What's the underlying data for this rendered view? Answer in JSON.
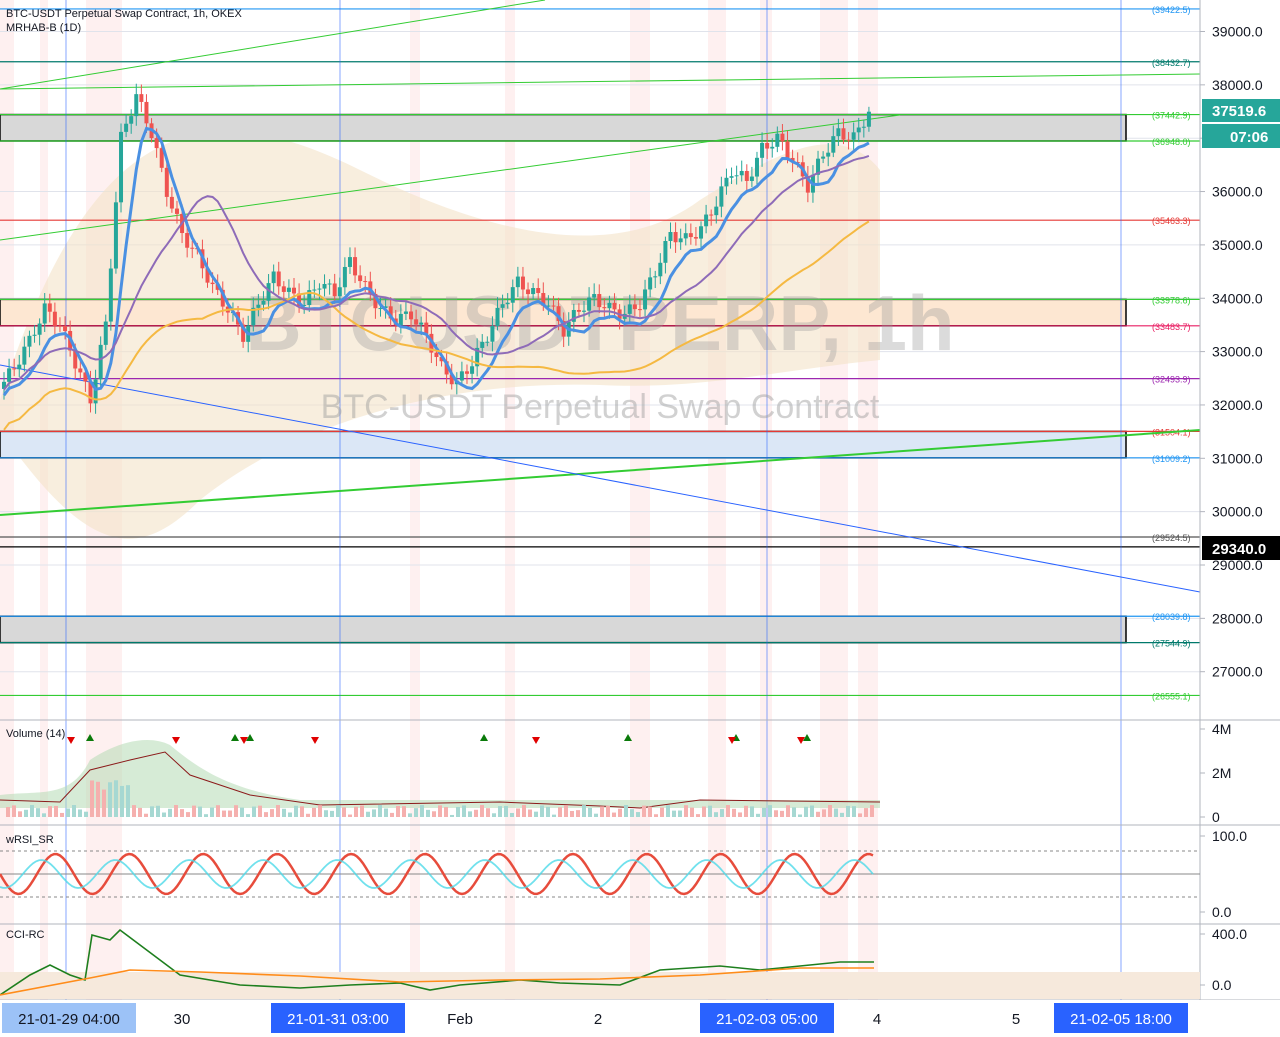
{
  "header": {
    "symbol_line": "BTC-USDT Perpetual Swap Contract, 1h, OKEX",
    "indicator_line": "MRHAB-B (1D)"
  },
  "watermark": {
    "ticker": "BTCUSDTPERP, 1h",
    "description": "BTC-USDT Perpetual Swap Contract"
  },
  "colors": {
    "up": "#26a69a",
    "down": "#ef5350",
    "bg": "#ffffff",
    "grid": "#e0e3eb",
    "axis_text": "#131722",
    "level_box": "#000000",
    "ema_fast": "#4a90e2",
    "ema_slow": "#f5b942",
    "trend_green": "#33cc33"
  },
  "price_axis": {
    "ticks": [
      "39000.0",
      "38000.0",
      "37000.0",
      "36000.0",
      "35000.0",
      "34000.0",
      "33000.0",
      "32000.0",
      "31000.0",
      "30000.0",
      "29000.0",
      "28000.0",
      "27000.0"
    ],
    "tick_values": [
      39000,
      38000,
      37000,
      36000,
      35000,
      34000,
      33000,
      32000,
      31000,
      30000,
      29000,
      28000,
      27000
    ],
    "current_price": "37519.6",
    "countdown": "07:06",
    "crosshair_price": "29340.0"
  },
  "levels": [
    {
      "label": "(39422.5)",
      "value": 39422.5,
      "color": "#2196f3"
    },
    {
      "label": "(38432.7)",
      "value": 38432.7,
      "color": "#00796b"
    },
    {
      "label": "(37442.9)",
      "value": 37442.9,
      "color": "#33cc33"
    },
    {
      "label": "(36948.0)",
      "value": 36948.0,
      "color": "#33cc33"
    },
    {
      "label": "(35463.3)",
      "value": 35463.3,
      "color": "#e53935"
    },
    {
      "label": "(33978.6)",
      "value": 33978.6,
      "color": "#33cc33"
    },
    {
      "label": "(33483.7)",
      "value": 33483.7,
      "color": "#e91e63"
    },
    {
      "label": "(32493.9)",
      "value": 32493.9,
      "color": "#9c27b0"
    },
    {
      "label": "(31504.1)",
      "value": 31504.1,
      "color": "#e53935"
    },
    {
      "label": "(31009.2)",
      "value": 31009.2,
      "color": "#2196f3"
    },
    {
      "label": "(29524.5)",
      "value": 29524.5,
      "color": "#555555"
    },
    {
      "label": "(28039.8)",
      "value": 28039.8,
      "color": "#2196f3"
    },
    {
      "label": "(27544.9)",
      "value": 27544.9,
      "color": "#00796b"
    },
    {
      "label": "(26555.1)",
      "value": 26555.1,
      "color": "#33cc33"
    }
  ],
  "zones": [
    {
      "top": 37442.9,
      "bottom": 36948.0,
      "fill": "#d8d8d8"
    },
    {
      "top": 33978.6,
      "bottom": 33483.7,
      "fill": "#fde7d2"
    },
    {
      "top": 31504.1,
      "bottom": 31009.2,
      "fill": "#dbe7f6"
    },
    {
      "top": 28039.8,
      "bottom": 27544.9,
      "fill": "#d8d8d8"
    }
  ],
  "volume_panel": {
    "title": "Volume (14)",
    "ticks": [
      "4M",
      "2M",
      "0"
    ]
  },
  "wrsi_panel": {
    "title": "wRSI_SR",
    "ticks": [
      "100.0",
      "0.0"
    ]
  },
  "cci_panel": {
    "title": "CCI-RC",
    "ticks": [
      "400.0",
      "0.0"
    ]
  },
  "time_axis": {
    "labels": [
      "21-01-29   04:00",
      "30",
      "21-01-31   03:00",
      "Feb",
      "2",
      "21-02-03   05:00",
      "4",
      "5",
      "21-02-05   18:00"
    ],
    "highlighted": [
      true,
      false,
      true,
      false,
      false,
      true,
      false,
      false,
      true
    ]
  },
  "chart_data": {
    "type": "candlestick",
    "title": "BTC-USDT Perpetual Swap Contract, 1h, OKEX",
    "ylim": [
      26000,
      39700
    ],
    "close_path": [
      32300,
      32700,
      33200,
      33800,
      33500,
      32800,
      32100,
      33500,
      37000,
      37800,
      37100,
      36000,
      35200,
      34800,
      34200,
      33800,
      33300,
      33900,
      34400,
      34100,
      33900,
      34300,
      34100,
      34700,
      34200,
      33800,
      33600,
      33700,
      33300,
      32700,
      32400,
      32800,
      33300,
      33900,
      34300,
      34100,
      33900,
      33400,
      33800,
      34000,
      33800,
      33700,
      33900,
      34500,
      35200,
      35100,
      35300,
      35800,
      36400,
      36200,
      36800,
      37000,
      36600,
      36100,
      36700,
      37100,
      37000,
      37500
    ]
  }
}
